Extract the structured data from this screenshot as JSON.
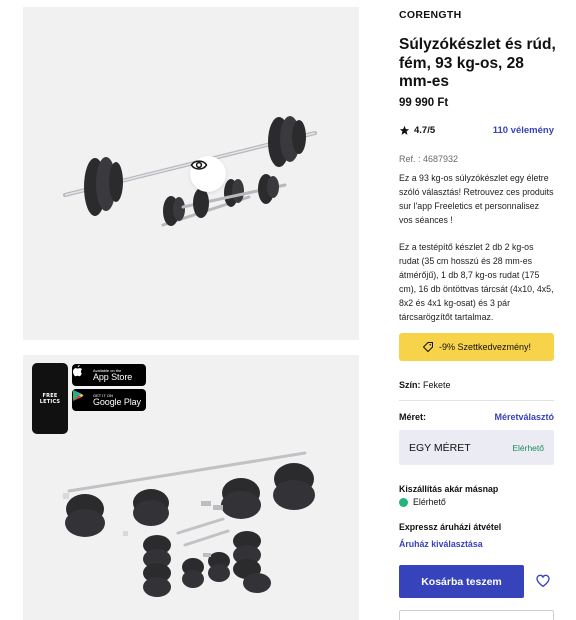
{
  "gallery": {
    "eye_icon": "eye-icon",
    "phone_brand": "FREE LETICS",
    "app_store": {
      "small": "Available on the",
      "big": "App Store"
    },
    "google_play": {
      "small": "GET IT ON",
      "big": "Google Play"
    }
  },
  "product": {
    "brand": "CORENGTH",
    "title": "Súlyzókészlet és rúd, fém, 93 kg-os, 28 mm-es",
    "price": "99 990 Ft",
    "rating": "4.7/5",
    "reviews": "110 vélemény",
    "ref": "Ref. : 4687932",
    "description_1": "Ez a 93 kg-os súlyzókészlet egy életre szóló választás! Retrouvez ces produits sur l'app Freeletics et personnalisez vos séances !",
    "description_2": "Ez a testépítő készlet 2 db 2 kg-os rudat (35 cm hosszú és 28 mm-es átmérőjű), 1 db 8,7 kg-os rudat (175 cm), 16 db öntöttvas tárcsát (4x10, 4x5, 8x2 és 4x1 kg-osat) és 3 pár tárcsarögzítőt tartalmaz.",
    "promo": "-9% Szettkedvezmény!",
    "color_label": "Szín:",
    "color_value": "Fekete",
    "size_label": "Méret:",
    "size_guide": "Méretválasztó",
    "size_value": "EGY MÉRET",
    "size_availability": "Elérhető",
    "shipping_title": "Kiszállítás akár másnap",
    "shipping_status": "Elérhető",
    "pickup_title": "Expressz áruházi átvétel",
    "pickup_link": "Áruház kiválasztása",
    "cart_button": "Kosárba teszem"
  },
  "colors": {
    "accent": "#3643ba",
    "promo": "#f7d34a",
    "available": "#22b47a"
  }
}
